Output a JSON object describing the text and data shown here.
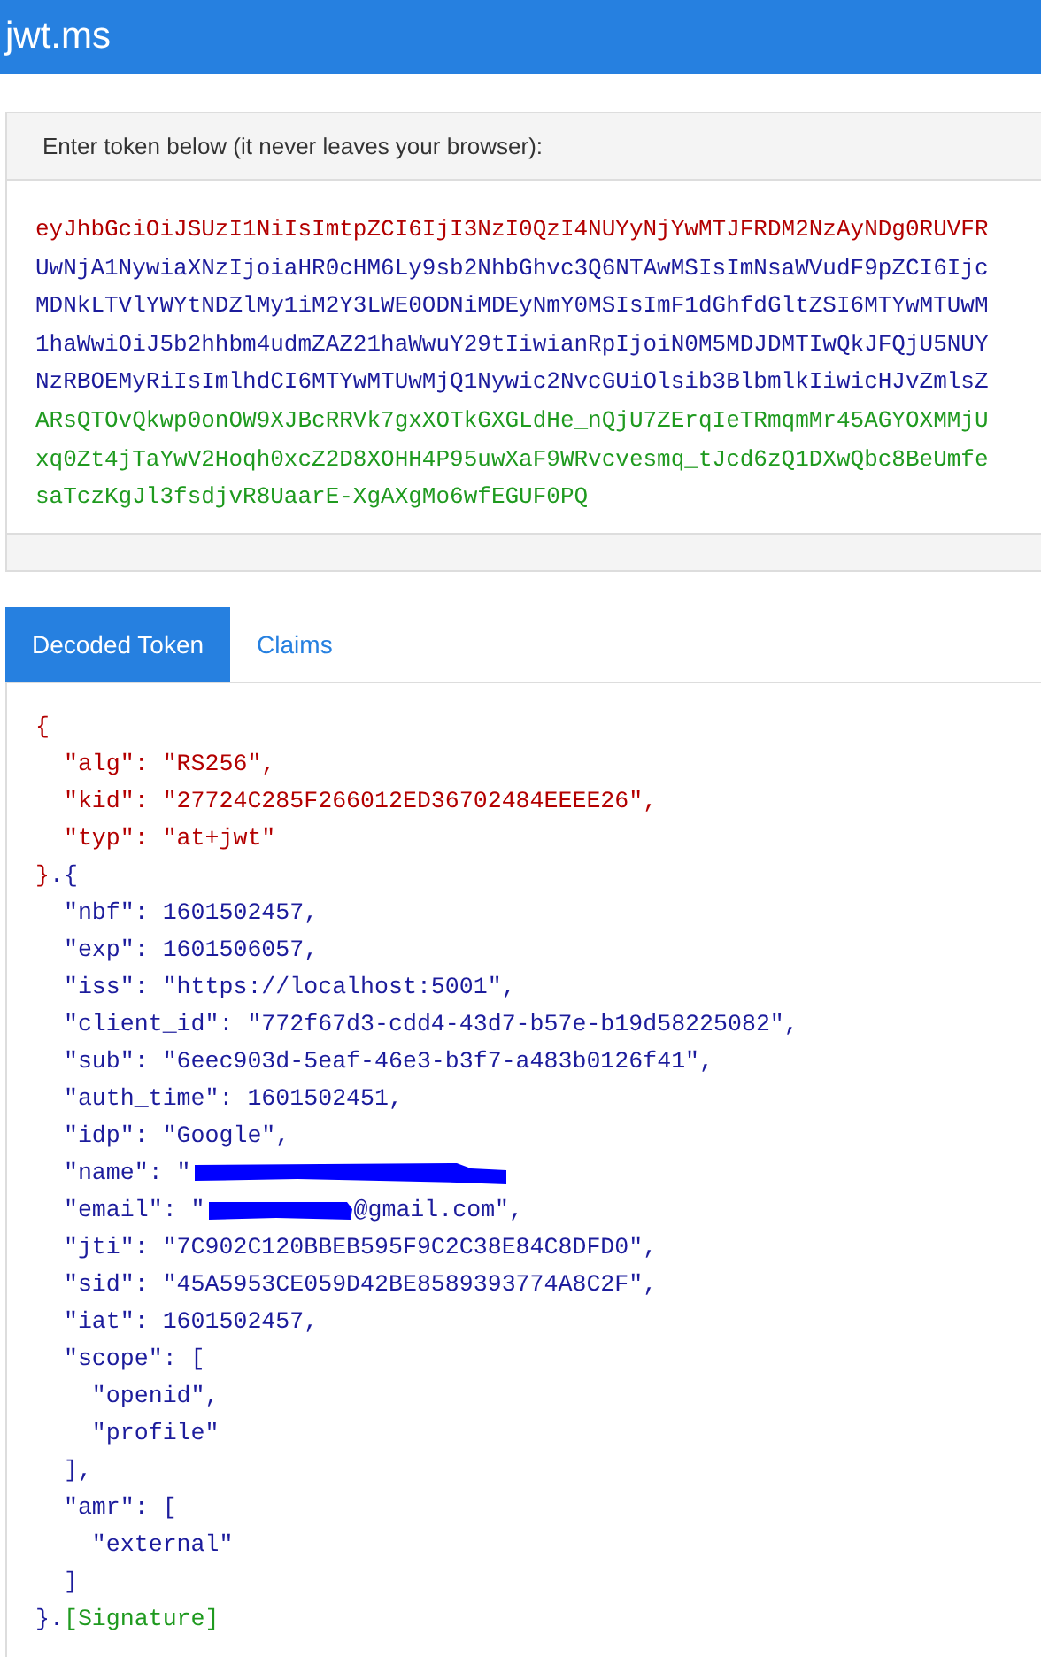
{
  "app_bar": {
    "title": "jwt.ms"
  },
  "token_panel": {
    "heading": "Enter token below (it never leaves your browser):",
    "lines": [
      {
        "text": "eyJhbGciOiJSUzI1NiIsImtpZCI6IjI3NzI0QzI4NUYyNjYwMTJFRDM2NzAyNDg0RUVFR",
        "color": "#b30000"
      },
      {
        "text": "UwNjA1NywiaXNzIjoiaHR0cHM6Ly9sb2NhbGhvc3Q6NTAwMSIsImNsaWVudF9pZCI6Ijc",
        "color": "#1c1c9c"
      },
      {
        "text": "MDNkLTVlYWYtNDZlMy1iM2Y3LWE0ODNiMDEyNmY0MSIsImF1dGhfdGltZSI6MTYwMTUwM",
        "color": "#1c1c9c"
      },
      {
        "text": "1haWwiOiJ5b2hhbm4udmZAZ21haWwuY29tIiwianRpIjoiN0M5MDJDMTIwQkJFQjU5NUY",
        "color": "#1c1c9c"
      },
      {
        "text": "NzRBOEMyRiIsImlhdCI6MTYwMTUwMjQ1Nywic2NvcGUiOlsib3BlbmlkIiwicHJvZmlsZ",
        "color": "#1c1c9c"
      },
      {
        "text": "ARsQTOvQkwp0onOW9XJBcRRVk7gxXOTkGXGLdHe_nQjU7ZErqIeTRmqmMr45AGYOXMMjU",
        "color": "#1f9a1f"
      },
      {
        "text": "xq0Zt4jTaYwV2Hoqh0xcZ2D8XOHH4P95uwXaF9WRvcvesmq_tJcd6zQ1DXwQbc8BeUmfe",
        "color": "#1f9a1f"
      },
      {
        "text": "saTczKgJl3fsdjvR8UaarE-XgAXgMo6wfEGUF0PQ",
        "color": "#1f9a1f"
      }
    ]
  },
  "tabs": [
    {
      "label": "Decoded Token",
      "selected": true
    },
    {
      "label": "Claims",
      "selected": false
    }
  ],
  "decoded": [
    {
      "segments": [
        {
          "kind": "text",
          "text": "{",
          "color": "#b30000"
        }
      ]
    },
    {
      "segments": [
        {
          "kind": "text",
          "text": "  \"alg\": \"RS256\",",
          "color": "#b30000"
        }
      ]
    },
    {
      "segments": [
        {
          "kind": "text",
          "text": "  \"kid\": \"27724C285F266012ED36702484EEEE26\",",
          "color": "#b30000"
        }
      ]
    },
    {
      "segments": [
        {
          "kind": "text",
          "text": "  \"typ\": \"at+jwt\"",
          "color": "#b30000"
        }
      ]
    },
    {
      "segments": [
        {
          "kind": "text",
          "text": "}",
          "color": "#b30000"
        },
        {
          "kind": "text",
          "text": ".{",
          "color": "#1c1c9c"
        }
      ]
    },
    {
      "segments": [
        {
          "kind": "text",
          "text": "  \"nbf\": 1601502457,",
          "color": "#1c1c9c"
        }
      ]
    },
    {
      "segments": [
        {
          "kind": "text",
          "text": "  \"exp\": 1601506057,",
          "color": "#1c1c9c"
        }
      ]
    },
    {
      "segments": [
        {
          "kind": "text",
          "text": "  \"iss\": \"https://localhost:5001\",",
          "color": "#1c1c9c"
        }
      ]
    },
    {
      "segments": [
        {
          "kind": "text",
          "text": "  \"client_id\": \"772f67d3-cdd4-43d7-b57e-b19d58225082\",",
          "color": "#1c1c9c"
        }
      ]
    },
    {
      "segments": [
        {
          "kind": "text",
          "text": "  \"sub\": \"6eec903d-5eaf-46e3-b3f7-a483b0126f41\",",
          "color": "#1c1c9c"
        }
      ]
    },
    {
      "segments": [
        {
          "kind": "text",
          "text": "  \"auth_time\": 1601502451,",
          "color": "#1c1c9c"
        }
      ]
    },
    {
      "segments": [
        {
          "kind": "text",
          "text": "  \"idp\": \"Google\",",
          "color": "#1c1c9c"
        }
      ]
    },
    {
      "segments": [
        {
          "kind": "text",
          "text": "  \"name\": \"",
          "color": "#1c1c9c"
        },
        {
          "kind": "redaction"
        }
      ]
    },
    {
      "segments": [
        {
          "kind": "text",
          "text": "  \"email\": \"",
          "color": "#1c1c9c"
        },
        {
          "kind": "redaction"
        },
        {
          "kind": "text",
          "text": "@gmail.com\",",
          "color": "#1c1c9c"
        }
      ]
    },
    {
      "segments": [
        {
          "kind": "text",
          "text": "  \"jti\": \"7C902C120BBEB595F9C2C38E84C8DFD0\",",
          "color": "#1c1c9c"
        }
      ]
    },
    {
      "segments": [
        {
          "kind": "text",
          "text": "  \"sid\": \"45A5953CE059D42BE8589393774A8C2F\",",
          "color": "#1c1c9c"
        }
      ]
    },
    {
      "segments": [
        {
          "kind": "text",
          "text": "  \"iat\": 1601502457,",
          "color": "#1c1c9c"
        }
      ]
    },
    {
      "segments": [
        {
          "kind": "text",
          "text": "  \"scope\": [",
          "color": "#1c1c9c"
        }
      ]
    },
    {
      "segments": [
        {
          "kind": "text",
          "text": "    \"openid\",",
          "color": "#1c1c9c"
        }
      ]
    },
    {
      "segments": [
        {
          "kind": "text",
          "text": "    \"profile\"",
          "color": "#1c1c9c"
        }
      ]
    },
    {
      "segments": [
        {
          "kind": "text",
          "text": "  ],",
          "color": "#1c1c9c"
        }
      ]
    },
    {
      "segments": [
        {
          "kind": "text",
          "text": "  \"amr\": [",
          "color": "#1c1c9c"
        }
      ]
    },
    {
      "segments": [
        {
          "kind": "text",
          "text": "    \"external\"",
          "color": "#1c1c9c"
        }
      ]
    },
    {
      "segments": [
        {
          "kind": "text",
          "text": "  ]",
          "color": "#1c1c9c"
        }
      ]
    },
    {
      "segments": [
        {
          "kind": "text",
          "text": "}.",
          "color": "#1c1c9c"
        },
        {
          "kind": "text",
          "text": "[Signature]",
          "color": "#1f9a1f"
        }
      ]
    }
  ]
}
